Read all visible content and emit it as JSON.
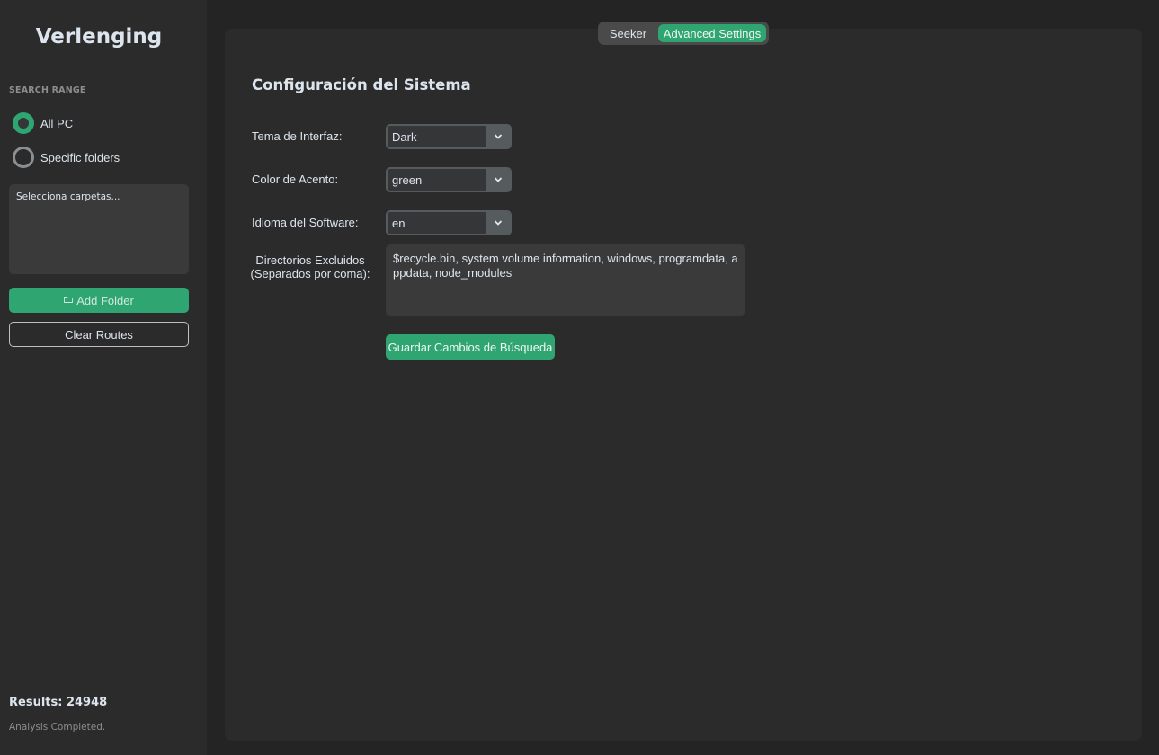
{
  "sidebar": {
    "app_title": "Verlenging",
    "search_range_label": "SEARCH RANGE",
    "radio_all_label": "All PC",
    "radio_specific_label": "Specific folders",
    "selected_range": "All PC",
    "folders_placeholder": "Selecciona carpetas...",
    "add_folder_label": "Add Folder",
    "add_folder_icon": "folder-icon",
    "clear_routes_label": "Clear Routes",
    "results_text": "Results: 24948",
    "status_text": "Analysis Completed."
  },
  "tabs": {
    "seeker_label": "Seeker",
    "advanced_label": "Advanced Settings",
    "active": "Advanced Settings"
  },
  "settings": {
    "title": "Configuración del Sistema",
    "theme_label": "Tema de Interfaz:",
    "theme_value": "Dark",
    "accent_label": "Color de Acento:",
    "accent_value": "green",
    "language_label": "Idioma del Software:",
    "language_value": "en",
    "excluded_label_line1": "Directorios Excluidos",
    "excluded_label_line2": "(Separados por coma):",
    "excluded_value": "$recycle.bin, system volume information, windows, programdata, appdata, node_modules",
    "save_label": "Guardar Cambios de Búsqueda"
  },
  "colors": {
    "accent": "#2fa572",
    "background": "#242424",
    "panel": "#2b2b2b"
  }
}
